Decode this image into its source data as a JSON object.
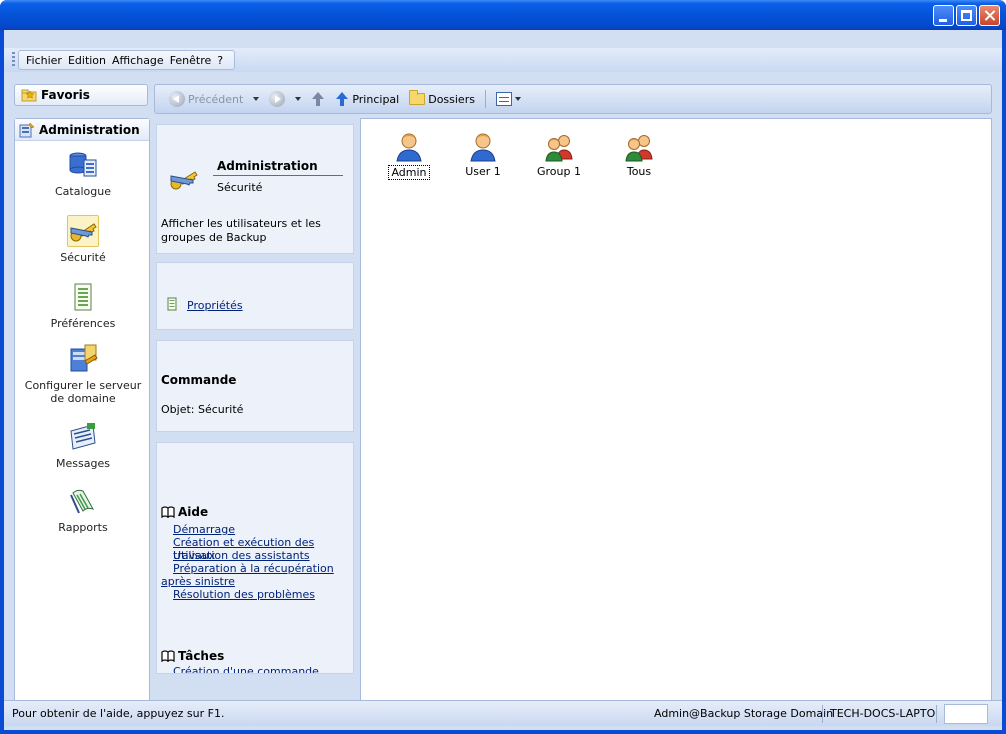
{
  "window": {
    "controls": {
      "minimize": "minimize-icon",
      "maximize": "maximize-icon",
      "close": "close-icon"
    }
  },
  "menu": {
    "items": [
      "Fichier",
      "Edition",
      "Affichage",
      "Fenêtre",
      "?"
    ]
  },
  "favoris": {
    "label": "Favoris"
  },
  "toolbar": {
    "back_label": "Précédent",
    "home_label": "Principal",
    "folders_label": "Dossiers"
  },
  "sidebar": {
    "header": "Administration",
    "items": [
      {
        "label": "Catalogue",
        "icon": "catalog-icon"
      },
      {
        "label": "Sécurité",
        "icon": "security-keys-icon",
        "selected": true
      },
      {
        "label": "Préférences",
        "icon": "preferences-document-icon"
      },
      {
        "label": "Configurer le serveur de domaine",
        "icon": "domain-server-icon"
      },
      {
        "label": "Messages",
        "icon": "messages-icon"
      },
      {
        "label": "Rapports",
        "icon": "reports-icon"
      }
    ]
  },
  "taskpane": {
    "info": {
      "title": "Administration",
      "subtitle": "Sécurité",
      "description": "Afficher les utilisateurs et les groupes de Backup"
    },
    "properties": {
      "link": "Propriétés"
    },
    "command": {
      "title": "Commande",
      "object": "Objet: Sécurité"
    },
    "help": {
      "title": "Aide",
      "links": [
        "Démarrage",
        "Création et exécution des travaux",
        "Utilisation des assistants",
        "Préparation à la récupération après sinistre",
        "Résolution des problèmes"
      ]
    },
    "tasks": {
      "title": "Tâches",
      "partial": "Création d'une commande"
    }
  },
  "content": {
    "items": [
      {
        "label": "Admin",
        "type": "user",
        "focused": true
      },
      {
        "label": "User 1",
        "type": "user"
      },
      {
        "label": "Group 1",
        "type": "group"
      },
      {
        "label": "Tous",
        "type": "group"
      }
    ]
  },
  "status": {
    "help": "Pour obtenir de l'aide, appuyez sur F1.",
    "user": "Admin@Backup Storage Domain",
    "machine": "TECH-DOCS-LAPTO"
  },
  "colors": {
    "titlebar": "#0553d8",
    "client": "#d2dff3",
    "link": "#00237a"
  }
}
